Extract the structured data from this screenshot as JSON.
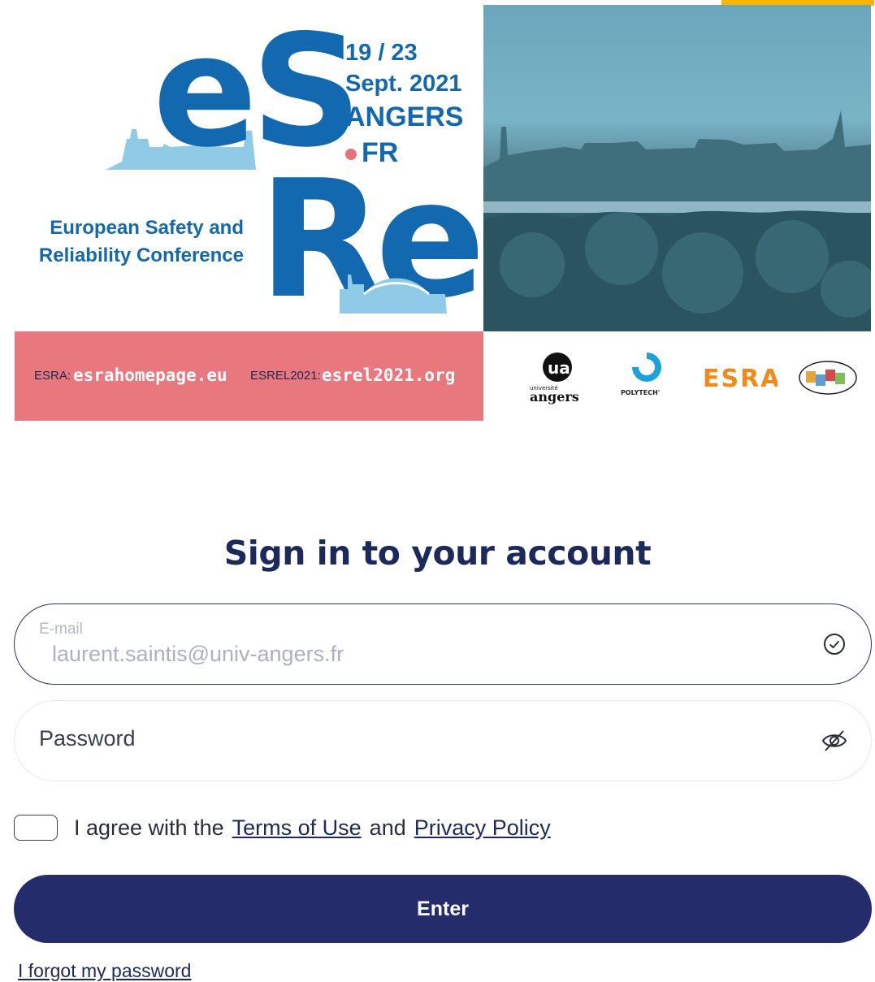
{
  "banner": {
    "logo_top": "eS",
    "logo_bottom": "Rel",
    "conference_line1": "European Safety and",
    "conference_line2": "Reliability Conference",
    "dates": "19 / 23",
    "month_year": "Sept. 2021",
    "city": "ANGERS",
    "country": "FR",
    "esra_label": "ESRA:",
    "esra_url": "esrahomepage.eu",
    "esrel_label": "ESREL2021:",
    "esrel_url": "esrel2021.org",
    "partners": [
      "ua angers",
      "POLYTECH",
      "ESRA",
      "LARIS"
    ],
    "colors": {
      "brand_blue": "#1269b0",
      "light_blue": "#8fcbe6",
      "pink": "#e8777e",
      "accent": "#f7b500"
    }
  },
  "signin": {
    "title": "Sign in to your account",
    "email_label": "E-mail",
    "email_value": "laurent.saintis@univ-angers.fr",
    "email_status_icon": "check-circle-icon",
    "password_placeholder": "Password",
    "password_toggle_icon": "eye-off-icon",
    "agree_prefix": "I agree with the",
    "terms_link": "Terms of Use",
    "agree_and": "and",
    "privacy_link": "Privacy Policy",
    "enter_button": "Enter",
    "forgot_link": "I forgot my password",
    "colors": {
      "primary": "#242c6b",
      "title": "#1b2a5a"
    }
  }
}
